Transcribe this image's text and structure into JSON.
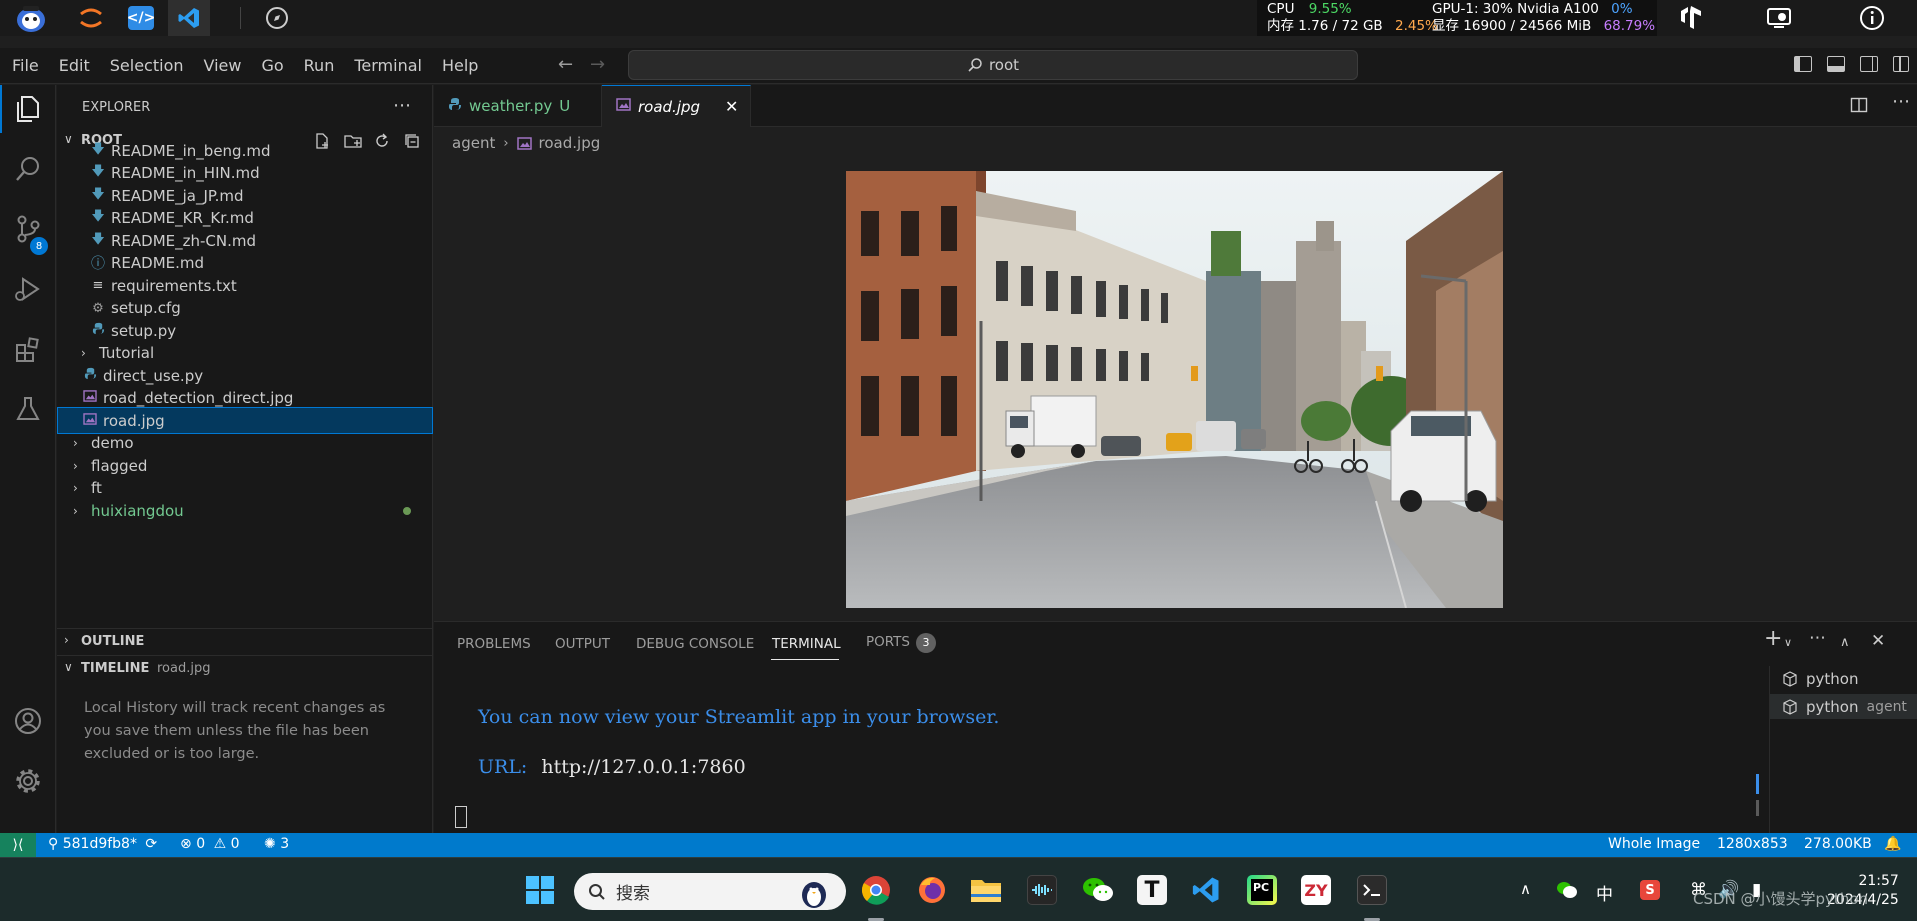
{
  "colors": {
    "accent": "#0078d4",
    "statusbar": "#007acc",
    "remote_button": "#16825d",
    "git_untracked": "#73c991",
    "markdown_icon": "#519aba",
    "terminal_blue": "#3b8eea"
  },
  "top_bar": {
    "cpu_label": "CPU",
    "cpu_value": "9.55%",
    "mem_label": "内存 1.76 / 72 GB",
    "mem_value": "2.45%",
    "gpu_label": "GPU-1: 30% Nvidia A100",
    "gpu_value": "0%",
    "vram_label": "显存 16900 / 24566 MiB",
    "vram_value": "68.79%"
  },
  "menu": {
    "items": [
      "File",
      "Edit",
      "Selection",
      "View",
      "Go",
      "Run",
      "Terminal",
      "Help"
    ],
    "search_text": "root"
  },
  "explorer": {
    "title": "EXPLORER",
    "root_label": "ROOT",
    "tree": [
      {
        "label": "README_in_beng.md",
        "icon": "markdown-icon",
        "indent": 2
      },
      {
        "label": "README_in_HIN.md",
        "icon": "markdown-icon",
        "indent": 2
      },
      {
        "label": "README_ja_JP.md",
        "icon": "markdown-icon",
        "indent": 2
      },
      {
        "label": "README_KR_Kr.md",
        "icon": "markdown-icon",
        "indent": 2
      },
      {
        "label": "README_zh-CN.md",
        "icon": "markdown-icon",
        "indent": 2
      },
      {
        "label": "README.md",
        "icon": "info-icon",
        "indent": 2
      },
      {
        "label": "requirements.txt",
        "icon": "text-file-icon",
        "indent": 2
      },
      {
        "label": "setup.cfg",
        "icon": "gear-file-icon",
        "indent": 2
      },
      {
        "label": "setup.py",
        "icon": "python-icon",
        "indent": 2
      },
      {
        "label": "Tutorial",
        "icon": "folder-chevron",
        "indent": 1
      },
      {
        "label": "direct_use.py",
        "icon": "python-icon",
        "indent": 1
      },
      {
        "label": "road_detection_direct.jpg",
        "icon": "image-icon",
        "indent": 1
      },
      {
        "label": "road.jpg",
        "icon": "image-icon",
        "indent": 1,
        "selected": true
      },
      {
        "label": "demo",
        "icon": "folder-chevron",
        "indent": 0
      },
      {
        "label": "flagged",
        "icon": "folder-chevron",
        "indent": 0
      },
      {
        "label": "ft",
        "icon": "folder-chevron",
        "indent": 0
      },
      {
        "label": "huixiangdou",
        "icon": "folder-chevron",
        "indent": 0,
        "modified": true
      }
    ],
    "outline_label": "OUTLINE",
    "timeline_label": "TIMELINE",
    "timeline_file": "road.jpg",
    "timeline_message": "Local History will track recent changes as you save them unless the file has been excluded or is too large."
  },
  "editor": {
    "tabs": [
      {
        "label": "weather.py",
        "badge": "U",
        "icon": "python-icon"
      },
      {
        "label": "road.jpg",
        "icon": "image-icon",
        "active": true,
        "close": "✕"
      }
    ],
    "breadcrumb": {
      "folder": "agent",
      "file": "road.jpg"
    }
  },
  "panel": {
    "tabs": [
      {
        "label": "PROBLEMS"
      },
      {
        "label": "OUTPUT"
      },
      {
        "label": "DEBUG CONSOLE"
      },
      {
        "label": "TERMINAL",
        "active": true
      },
      {
        "label": "PORTS",
        "badge": "3"
      }
    ],
    "terminal_lines": [
      {
        "prefix": "",
        "text": "You can now view your Streamlit app in your browser."
      },
      {
        "prefix": "URL:",
        "text": "http://127.0.0.1:7860"
      }
    ],
    "terminals": [
      {
        "name": "python",
        "sub": ""
      },
      {
        "name": "python",
        "sub": "agent"
      }
    ]
  },
  "statusbar": {
    "branch": "581d9fb8*",
    "problems": "0",
    "warnings": "0",
    "ports": "3",
    "image_mode": "Whole Image",
    "dimensions": "1280x853",
    "size": "278.00KB"
  },
  "taskbar": {
    "search_placeholder": "搜索",
    "ime": "中",
    "time": "21:57",
    "date": "2024/4/25",
    "watermark": "CSDN @小馒头学python"
  }
}
